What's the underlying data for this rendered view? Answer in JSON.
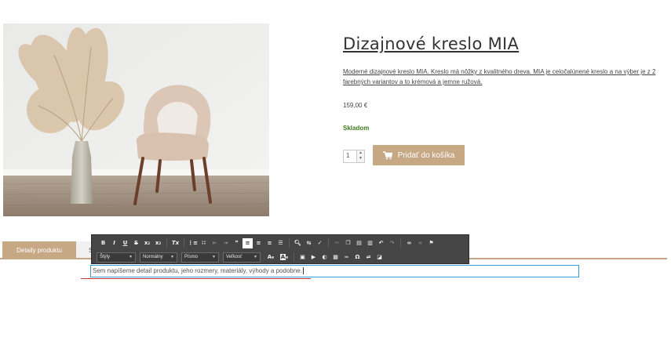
{
  "product": {
    "title": "Dizajnové kreslo MIA",
    "description": "Moderné dizajnové kreslo MIA. Kreslo má nôžky z kvalitného dreva. MIA je celočalúnené kreslo a na výber je z 2 farebných variantov a to krémová a jemne ružová.",
    "price": "159,00 €",
    "stock": "Skladom",
    "quantity": "1",
    "add_to_cart": "Pridať do košíka",
    "cart_icon": "cart-icon"
  },
  "colors": {
    "accent": "#c7a885",
    "stock": "#3e7b1f",
    "editor_border": "#3a9bd9",
    "toolbar_bg": "#454545"
  },
  "tabs": [
    {
      "label": "Detaily produktu",
      "active": true
    },
    {
      "label": "S",
      "active": false
    }
  ],
  "toolbar": {
    "row1": {
      "bold": "B",
      "italic": "I",
      "underline": "U",
      "strike": "S",
      "subscript": "x",
      "superscript": "x",
      "remove_format": "Tx"
    },
    "row2": {
      "styles": "Štýly",
      "format": "Normálny",
      "font": "Písmo",
      "size": "Veľkosť",
      "text_color": "A",
      "bg_color": "A"
    }
  },
  "editor": {
    "content": "Sem napíšeme detail produktu, jeho rozmery, materiály, výhody a podobne."
  }
}
